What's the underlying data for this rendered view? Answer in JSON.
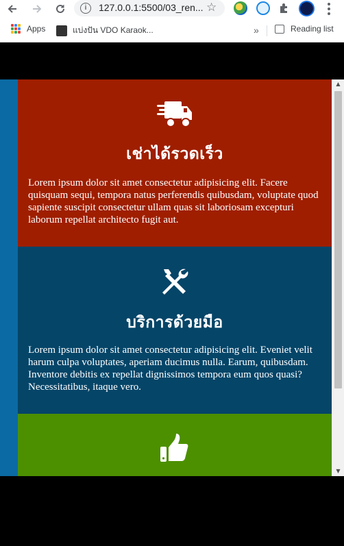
{
  "browser": {
    "url": "127.0.0.1:5500/03_ren...",
    "info_icon": "info-icon",
    "star_icon": "star-icon",
    "bookmarks": [
      {
        "label": "Apps",
        "icon": "apps-grid-icon"
      },
      {
        "label": "แบ่งปัน VDO Karaok...",
        "icon": "karaoke-favicon"
      }
    ],
    "overflow_label": "»",
    "reading_list_label": "Reading list"
  },
  "cards": [
    {
      "icon": "truck-fast-icon",
      "title": "เช่าได้รวดเร็ว",
      "text": "Lorem ipsum dolor sit amet consectetur adipisicing elit. Facere quisquam sequi, tempora natus perferendis quibusdam, voluptate quod sapiente suscipit consectetur ullam quas sit laboriosam excepturi laborum repellat architecto fugit aut.",
      "color": "#9f1e00"
    },
    {
      "icon": "tools-icon",
      "title": "บริการด้วยมือ",
      "text": "Lorem ipsum dolor sit amet consectetur adipisicing elit. Eveniet velit harum culpa voluptates, aperiam ducimus nulla. Earum, quibusdam. Inventore debitis ex repellat dignissimos tempora eum quos quasi? Necessitatibus, itaque vero.",
      "color": "#054568"
    },
    {
      "icon": "thumbs-up-icon",
      "title": "",
      "text": "",
      "color": "#4c9000"
    }
  ],
  "colors": {
    "accent_strip": "#0b6aa3",
    "background": "#000000"
  }
}
